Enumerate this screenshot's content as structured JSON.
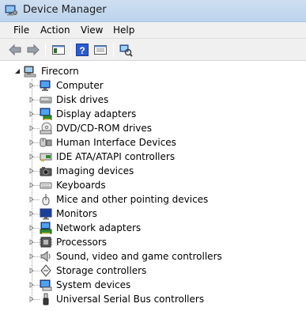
{
  "window": {
    "title": "Device Manager"
  },
  "menu": {
    "items": [
      {
        "label": "File"
      },
      {
        "label": "Action"
      },
      {
        "label": "View"
      },
      {
        "label": "Help"
      }
    ]
  },
  "toolbar": {
    "buttons": [
      "back-icon",
      "forward-icon",
      "show-hide-console-tree-icon",
      "help-icon",
      "properties-icon",
      "scan-hardware-icon"
    ]
  },
  "tree": {
    "root": {
      "label": "Firecorn",
      "icon": "computer-icon",
      "expanded": true
    },
    "children": [
      {
        "label": "Computer",
        "icon": "computer-icon"
      },
      {
        "label": "Disk drives",
        "icon": "disk-drive-icon"
      },
      {
        "label": "Display adapters",
        "icon": "display-adapter-icon"
      },
      {
        "label": "DVD/CD-ROM drives",
        "icon": "dvd-drive-icon"
      },
      {
        "label": "Human Interface Devices",
        "icon": "hid-icon"
      },
      {
        "label": "IDE ATA/ATAPI controllers",
        "icon": "ide-controller-icon"
      },
      {
        "label": "Imaging devices",
        "icon": "camera-icon"
      },
      {
        "label": "Keyboards",
        "icon": "keyboard-icon"
      },
      {
        "label": "Mice and other pointing devices",
        "icon": "mouse-icon"
      },
      {
        "label": "Monitors",
        "icon": "monitor-icon"
      },
      {
        "label": "Network adapters",
        "icon": "network-adapter-icon"
      },
      {
        "label": "Processors",
        "icon": "processor-icon"
      },
      {
        "label": "Sound, video and game controllers",
        "icon": "speaker-icon"
      },
      {
        "label": "Storage controllers",
        "icon": "storage-controller-icon"
      },
      {
        "label": "System devices",
        "icon": "system-devices-icon"
      },
      {
        "label": "Universal Serial Bus controllers",
        "icon": "usb-icon"
      }
    ]
  }
}
